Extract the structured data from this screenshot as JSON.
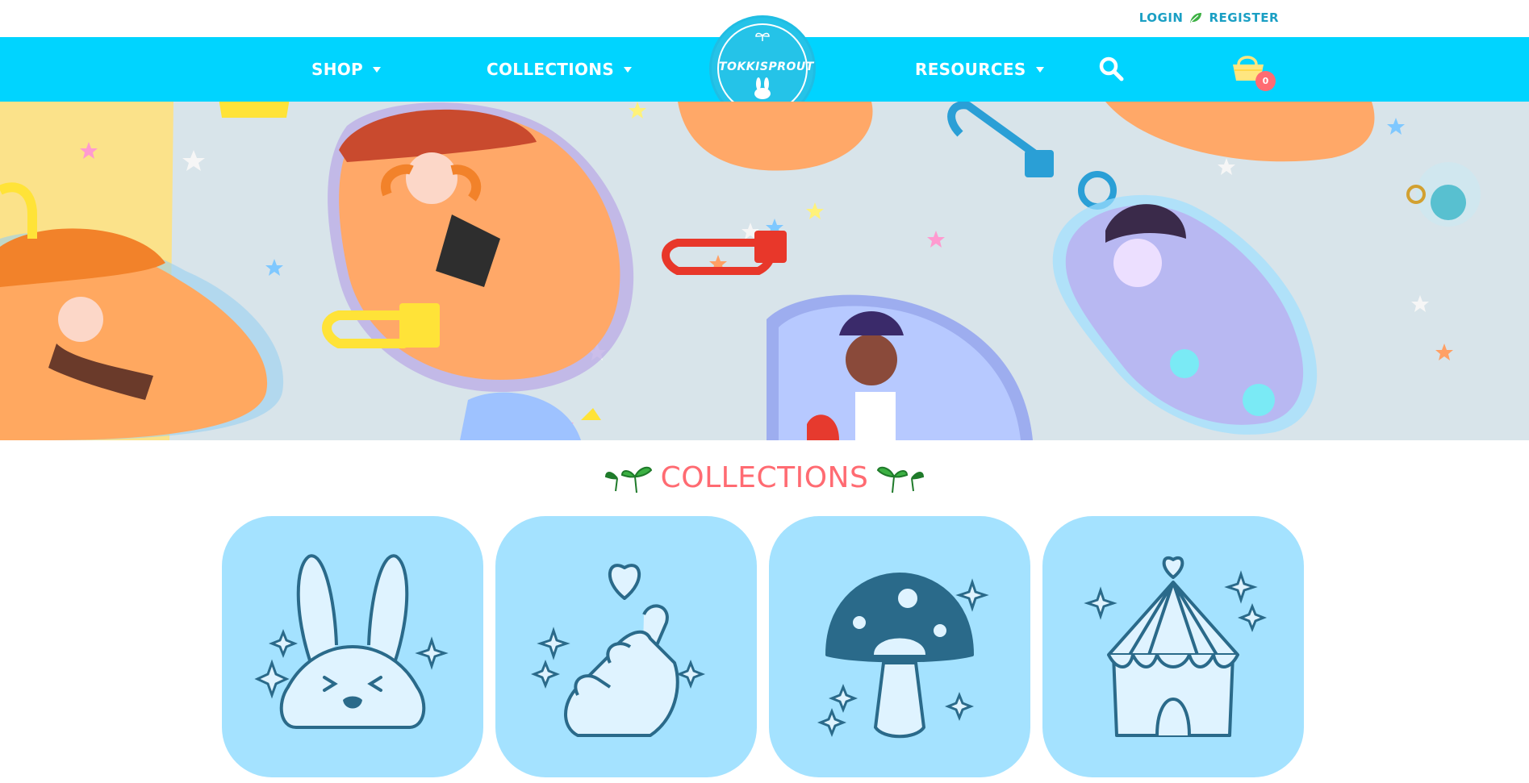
{
  "header": {
    "login_label": "LOGIN",
    "register_label": "REGISTER",
    "divider_icon": "leaf-icon"
  },
  "nav": {
    "items": [
      {
        "label": "SHOP",
        "icon": "caret-down-icon"
      },
      {
        "label": "COLLECTIONS",
        "icon": "caret-down-icon"
      },
      {
        "label": "RESOURCES",
        "icon": "caret-down-icon"
      }
    ],
    "logo_text": "TOKKISPROUT",
    "search_icon": "search-icon",
    "cart_icon": "basket-icon",
    "cart_count": "0"
  },
  "hero": {
    "image": "acrylic-charms-photo"
  },
  "collections": {
    "heading": "COLLECTIONS",
    "tiles": [
      {
        "icon": "bunny-icon"
      },
      {
        "icon": "finger-heart-icon"
      },
      {
        "icon": "mushroom-icon"
      },
      {
        "icon": "circus-tent-icon"
      }
    ]
  },
  "colors": {
    "nav_bg": "#00d4ff",
    "logo_bg": "#25c3e8",
    "link_color": "#1a9fc4",
    "heading_color": "#ff6b72",
    "tile_bg": "#a4e2ff",
    "icon_stroke": "#2a6a8a",
    "sprout_green": "#3cb043"
  }
}
